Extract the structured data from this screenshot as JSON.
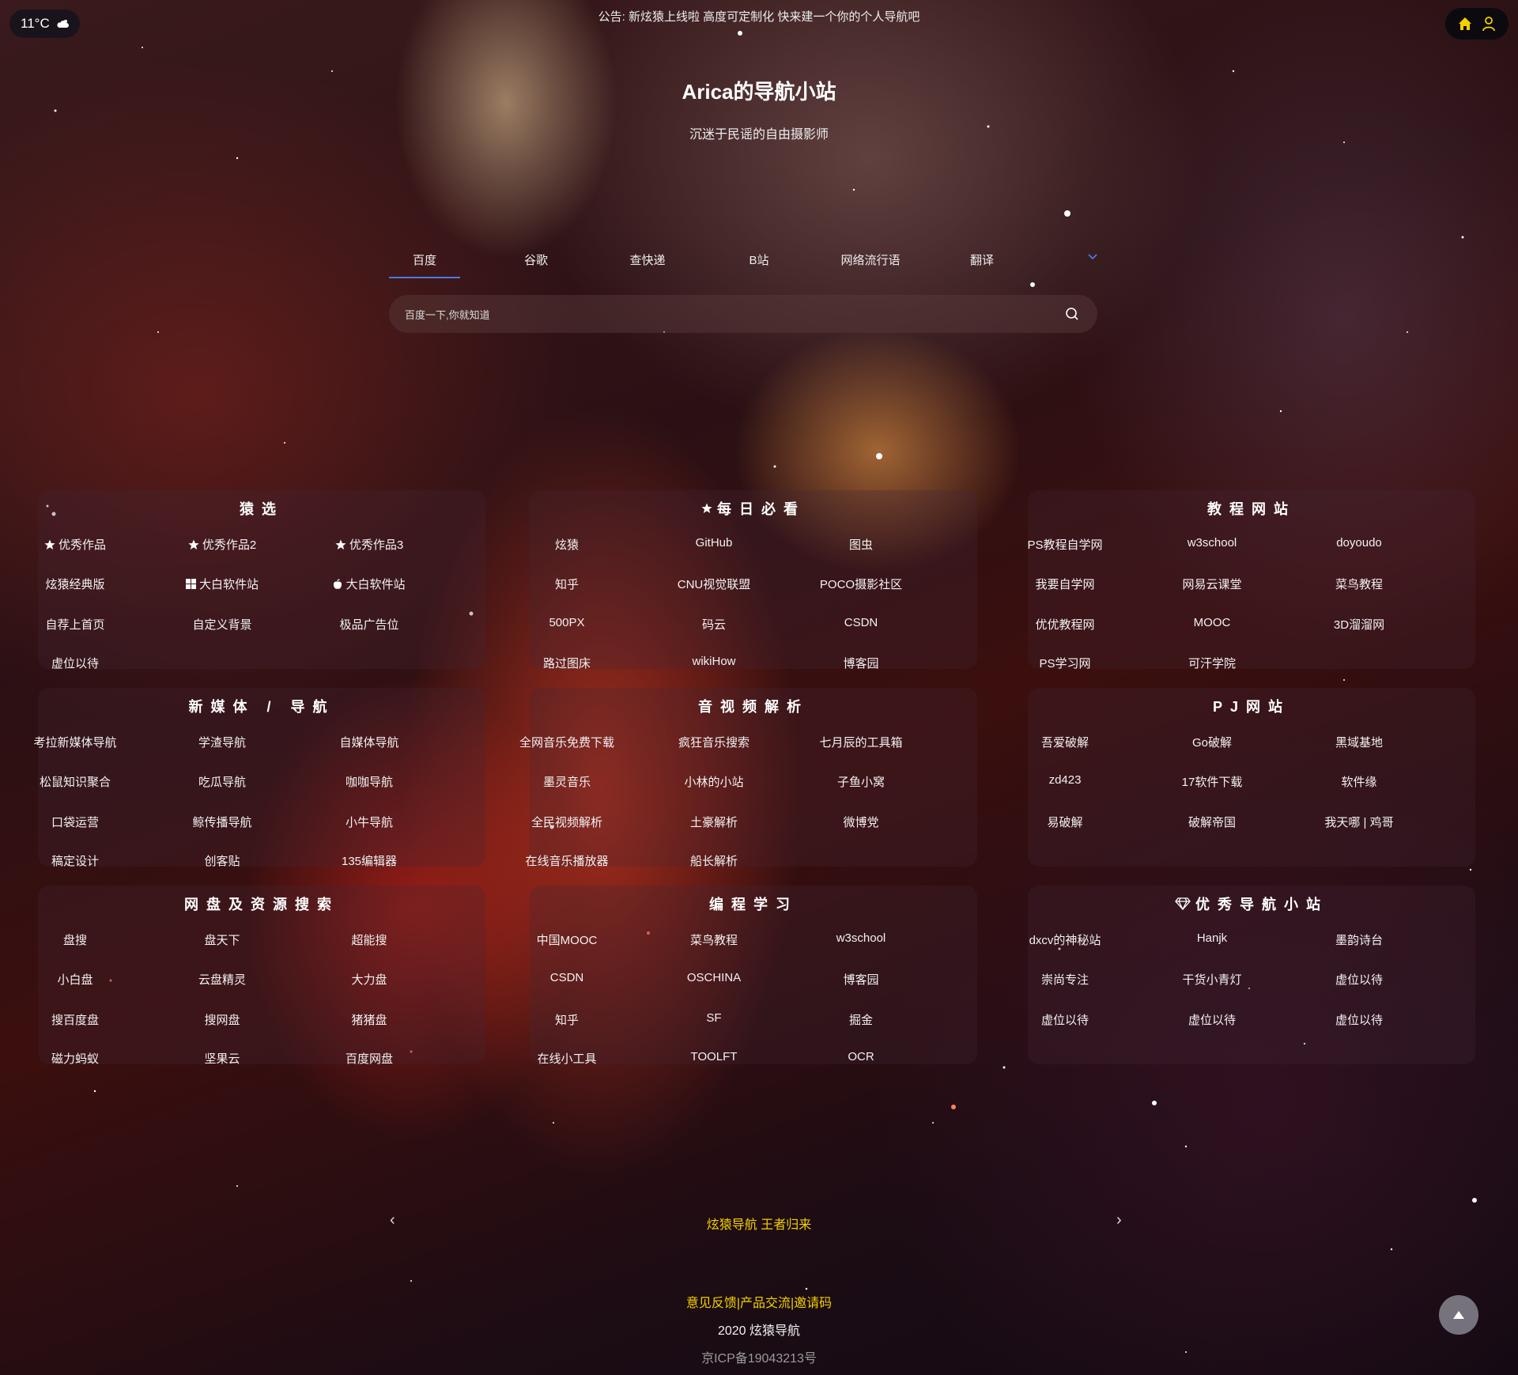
{
  "weather": {
    "temperature": "11°C",
    "icon": "cloud-sun-icon"
  },
  "notice": "公告: 新炫猿上线啦 高度可定制化 快来建一个你的个人导航吧",
  "site": {
    "title": "Arica的导航小站",
    "subtitle": "沉迷于民谣的自由摄影师"
  },
  "search": {
    "tabs": [
      "百度",
      "谷歌",
      "查快递",
      "B站",
      "网络流行语",
      "翻译"
    ],
    "active_tab": "百度",
    "placeholder": "百度一下,你就知道",
    "accent_color": "#4a7bdc"
  },
  "cards": [
    {
      "title": "猿选",
      "icon": "",
      "links": [
        {
          "label": "优秀作品",
          "icon": "star-icon"
        },
        {
          "label": "优秀作品2",
          "icon": "star-icon"
        },
        {
          "label": "优秀作品3",
          "icon": "star-icon"
        },
        {
          "label": "炫猿经典版",
          "icon": ""
        },
        {
          "label": "大白软件站",
          "icon": "windows-icon"
        },
        {
          "label": "大白软件站",
          "icon": "apple-icon"
        },
        {
          "label": "自荐上首页",
          "icon": ""
        },
        {
          "label": "自定义背景",
          "icon": ""
        },
        {
          "label": "极品广告位",
          "icon": ""
        },
        {
          "label": "虚位以待",
          "icon": ""
        }
      ]
    },
    {
      "title": "每日必看",
      "icon": "star-icon",
      "links": [
        {
          "label": "炫猿",
          "icon": ""
        },
        {
          "label": "GitHub",
          "icon": ""
        },
        {
          "label": "图虫",
          "icon": ""
        },
        {
          "label": "知乎",
          "icon": ""
        },
        {
          "label": "CNU视觉联盟",
          "icon": ""
        },
        {
          "label": "POCO摄影社区",
          "icon": ""
        },
        {
          "label": "500PX",
          "icon": ""
        },
        {
          "label": "码云",
          "icon": ""
        },
        {
          "label": "CSDN",
          "icon": ""
        },
        {
          "label": "路过图床",
          "icon": ""
        },
        {
          "label": "wikiHow",
          "icon": ""
        },
        {
          "label": "博客园",
          "icon": ""
        }
      ]
    },
    {
      "title": "教程网站",
      "icon": "",
      "links": [
        {
          "label": "PS教程自学网",
          "icon": ""
        },
        {
          "label": "w3school",
          "icon": ""
        },
        {
          "label": "doyoudo",
          "icon": ""
        },
        {
          "label": "我要自学网",
          "icon": ""
        },
        {
          "label": "网易云课堂",
          "icon": ""
        },
        {
          "label": "菜鸟教程",
          "icon": ""
        },
        {
          "label": "优优教程网",
          "icon": ""
        },
        {
          "label": "MOOC",
          "icon": ""
        },
        {
          "label": "3D溜溜网",
          "icon": ""
        },
        {
          "label": "PS学习网",
          "icon": ""
        },
        {
          "label": "可汗学院",
          "icon": ""
        }
      ]
    },
    {
      "title": "新媒体 / 导航",
      "icon": "",
      "links": [
        {
          "label": "考拉新媒体导航",
          "icon": ""
        },
        {
          "label": "学渣导航",
          "icon": ""
        },
        {
          "label": "自媒体导航",
          "icon": ""
        },
        {
          "label": "松鼠知识聚合",
          "icon": ""
        },
        {
          "label": "吃瓜导航",
          "icon": ""
        },
        {
          "label": "咖咖导航",
          "icon": ""
        },
        {
          "label": "口袋运营",
          "icon": ""
        },
        {
          "label": "鲸传播导航",
          "icon": ""
        },
        {
          "label": "小牛导航",
          "icon": ""
        },
        {
          "label": "稿定设计",
          "icon": ""
        },
        {
          "label": "创客贴",
          "icon": ""
        },
        {
          "label": "135编辑器",
          "icon": ""
        }
      ]
    },
    {
      "title": "音视频解析",
      "icon": "",
      "links": [
        {
          "label": "全网音乐免费下载",
          "icon": ""
        },
        {
          "label": "疯狂音乐搜索",
          "icon": ""
        },
        {
          "label": "七月辰的工具箱",
          "icon": ""
        },
        {
          "label": "墨灵音乐",
          "icon": ""
        },
        {
          "label": "小林的小站",
          "icon": ""
        },
        {
          "label": "子鱼小窝",
          "icon": ""
        },
        {
          "label": "全民视频解析",
          "icon": ""
        },
        {
          "label": "土豪解析",
          "icon": ""
        },
        {
          "label": "微博党",
          "icon": ""
        },
        {
          "label": "在线音乐播放器",
          "icon": ""
        },
        {
          "label": "船长解析",
          "icon": ""
        }
      ]
    },
    {
      "title": "PJ网站",
      "icon": "",
      "links": [
        {
          "label": "吾爱破解",
          "icon": ""
        },
        {
          "label": "Go破解",
          "icon": ""
        },
        {
          "label": "黑域基地",
          "icon": ""
        },
        {
          "label": "zd423",
          "icon": ""
        },
        {
          "label": "17软件下载",
          "icon": ""
        },
        {
          "label": "软件缘",
          "icon": ""
        },
        {
          "label": "易破解",
          "icon": ""
        },
        {
          "label": "破解帝国",
          "icon": ""
        },
        {
          "label": "我天哪 | 鸡哥",
          "icon": ""
        }
      ]
    },
    {
      "title": "网盘及资源搜索",
      "icon": "",
      "links": [
        {
          "label": "盘搜",
          "icon": ""
        },
        {
          "label": "盘天下",
          "icon": ""
        },
        {
          "label": "超能搜",
          "icon": ""
        },
        {
          "label": "小白盘",
          "icon": ""
        },
        {
          "label": "云盘精灵",
          "icon": ""
        },
        {
          "label": "大力盘",
          "icon": ""
        },
        {
          "label": "搜百度盘",
          "icon": ""
        },
        {
          "label": "搜网盘",
          "icon": ""
        },
        {
          "label": "猪猪盘",
          "icon": ""
        },
        {
          "label": "磁力蚂蚁",
          "icon": ""
        },
        {
          "label": "坚果云",
          "icon": ""
        },
        {
          "label": "百度网盘",
          "icon": ""
        }
      ]
    },
    {
      "title": "编程学习",
      "icon": "",
      "links": [
        {
          "label": "中国MOOC",
          "icon": ""
        },
        {
          "label": "菜鸟教程",
          "icon": ""
        },
        {
          "label": "w3school",
          "icon": ""
        },
        {
          "label": "CSDN",
          "icon": ""
        },
        {
          "label": "OSCHINA",
          "icon": ""
        },
        {
          "label": "博客园",
          "icon": ""
        },
        {
          "label": "知乎",
          "icon": ""
        },
        {
          "label": "SF",
          "icon": ""
        },
        {
          "label": "掘金",
          "icon": ""
        },
        {
          "label": "在线小工具",
          "icon": ""
        },
        {
          "label": "TOOLFT",
          "icon": ""
        },
        {
          "label": "OCR",
          "icon": ""
        }
      ]
    },
    {
      "title": "优秀导航小站",
      "icon": "diamond-icon",
      "links": [
        {
          "label": "dxcv的神秘站",
          "icon": ""
        },
        {
          "label": "Hanjk",
          "icon": ""
        },
        {
          "label": "墨韵诗台",
          "icon": ""
        },
        {
          "label": "崇尚专注",
          "icon": ""
        },
        {
          "label": "干货小青灯",
          "icon": ""
        },
        {
          "label": "虚位以待",
          "icon": ""
        },
        {
          "label": "虚位以待",
          "icon": ""
        },
        {
          "label": "虚位以待",
          "icon": ""
        },
        {
          "label": "虚位以待",
          "icon": ""
        }
      ]
    }
  ],
  "carousel": {
    "text": "炫猿导航 王者归来",
    "prev": "‹",
    "next": "›"
  },
  "footer": {
    "links": [
      "意见反馈",
      "产品交流",
      "邀请码"
    ],
    "separator": "|",
    "copyright": "2020 炫猿导航",
    "icp": "京ICP备19043213号"
  },
  "colors": {
    "highlight": "#f3d000",
    "home_icon": "#f3d000"
  }
}
